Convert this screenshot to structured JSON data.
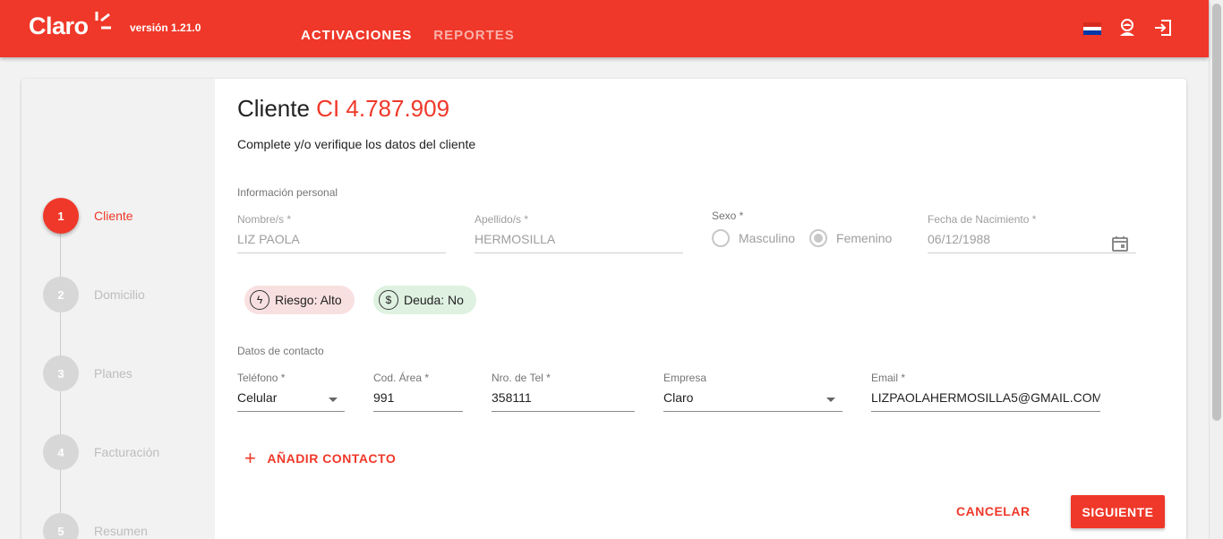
{
  "header": {
    "brand": "Claro",
    "version": "versión 1.21.0",
    "nav": [
      {
        "label": "ACTIVACIONES",
        "active": true
      },
      {
        "label": "REPORTES",
        "active": false
      }
    ],
    "icons": [
      "paraguay-flag-icon",
      "user-icon",
      "logout-icon"
    ],
    "accent_color": "#ef3829"
  },
  "stepper": {
    "steps": [
      {
        "number": "1",
        "label": "Cliente",
        "active": true
      },
      {
        "number": "2",
        "label": "Domicilio",
        "active": false
      },
      {
        "number": "3",
        "label": "Planes",
        "active": false
      },
      {
        "number": "4",
        "label": "Facturación",
        "active": false
      },
      {
        "number": "5",
        "label": "Resumen",
        "active": false
      }
    ]
  },
  "form": {
    "title_prefix": "Cliente",
    "title_id": "CI 4.787.909",
    "subtitle": "Complete y/o verifique los datos del cliente",
    "personal_section": "Información personal",
    "nombre": {
      "label": "Nombre/s *",
      "value": "LIZ PAOLA"
    },
    "apellido": {
      "label": "Apellido/s *",
      "value": "HERMOSILLA"
    },
    "sexo": {
      "label": "Sexo *",
      "options": [
        "Masculino",
        "Femenino"
      ],
      "selected": "Femenino"
    },
    "fecha": {
      "label": "Fecha de Nacimiento *",
      "value": "06/12/1988"
    },
    "chips": {
      "riesgo": "Riesgo: Alto",
      "deuda": "Deuda: No"
    },
    "contact_section": "Datos de contacto",
    "telefono": {
      "label": "Teléfono *",
      "value": "Celular"
    },
    "cod_area": {
      "label": "Cod. Área *",
      "value": "991"
    },
    "nro_tel": {
      "label": "Nro. de Tel *",
      "value": "358111"
    },
    "empresa": {
      "label": "Empresa",
      "value": "Claro"
    },
    "email": {
      "label": "Email *",
      "value": "LIZPAOLAHERMOSILLA5@GMAIL.COM"
    },
    "add_contact": "AÑADIR CONTACTO",
    "cancel": "CANCELAR",
    "next": "SIGUIENTE"
  }
}
